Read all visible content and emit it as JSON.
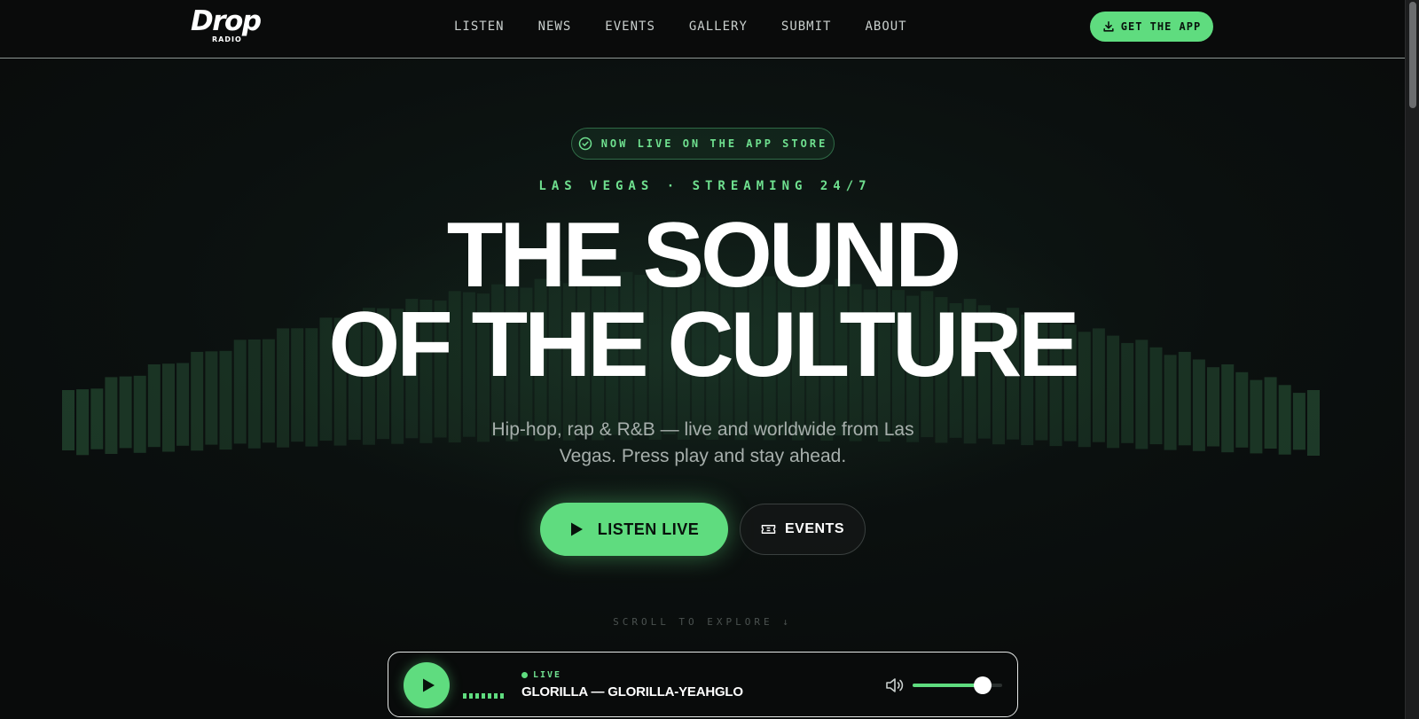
{
  "nav": {
    "logo": {
      "word": "Drop",
      "sub": "RADIO"
    },
    "links": [
      "LISTEN",
      "NEWS",
      "EVENTS",
      "GALLERY",
      "SUBMIT",
      "ABOUT"
    ],
    "cta": {
      "label": "GET THE APP",
      "icon": "download-icon"
    }
  },
  "hero": {
    "badge": {
      "label": "NOW LIVE ON THE APP STORE",
      "icon": "check-circle-icon"
    },
    "eyebrow": "LAS VEGAS · STREAMING 24/7",
    "headline": [
      "THE SOUND",
      "OF THE CULTURE"
    ],
    "subline": "Hip-hop, rap & R&B — live and worldwide from Las Vegas. Press play and stay ahead.",
    "primary_button": {
      "label": "LISTEN LIVE",
      "icon": "play-icon"
    },
    "secondary_button": {
      "label": "EVENTS",
      "icon": "ticket-icon"
    },
    "scroll_hint": "SCROLL TO EXPLORE ↓"
  },
  "player": {
    "play_icon": "play-icon",
    "live_label": "LIVE",
    "track": "GLORILLA — GLORILLA-YEAHGLO",
    "volume_icon": "volume-icon",
    "volume_level": 0.78
  },
  "colors": {
    "accent": "#5fdc7f",
    "accent_text": "#6fe08f",
    "background": "#0a0c0c"
  }
}
